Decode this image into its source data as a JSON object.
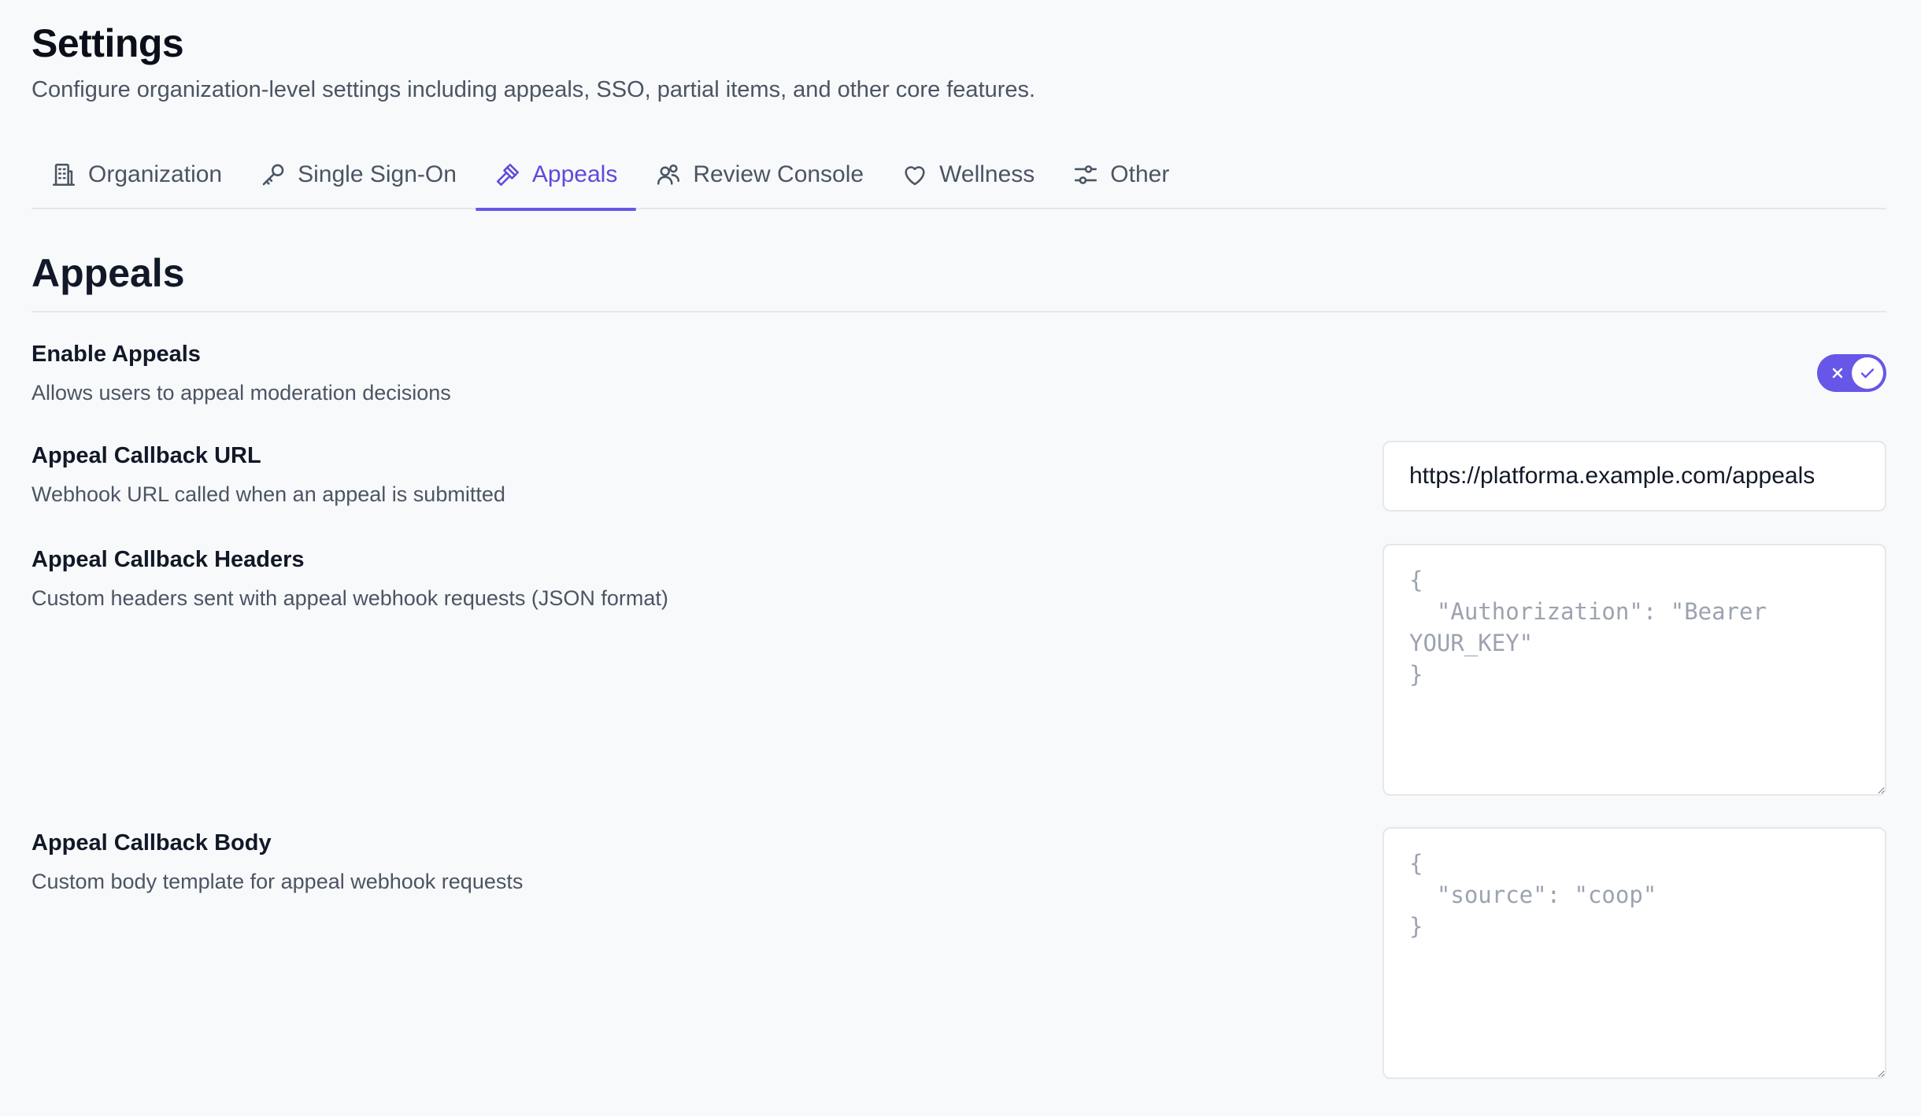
{
  "header": {
    "title": "Settings",
    "subtitle": "Configure organization-level settings including appeals, SSO, partial items, and other core features."
  },
  "tabs": [
    {
      "label": "Organization",
      "icon": "building-icon",
      "active": false
    },
    {
      "label": "Single Sign-On",
      "icon": "key-icon",
      "active": false
    },
    {
      "label": "Appeals",
      "icon": "gavel-icon",
      "active": true
    },
    {
      "label": "Review Console",
      "icon": "users-icon",
      "active": false
    },
    {
      "label": "Wellness",
      "icon": "heart-icon",
      "active": false
    },
    {
      "label": "Other",
      "icon": "sliders-icon",
      "active": false
    }
  ],
  "section": {
    "title": "Appeals"
  },
  "settings": {
    "enable_appeals": {
      "label": "Enable Appeals",
      "description": "Allows users to appeal moderation decisions",
      "enabled": true
    },
    "callback_url": {
      "label": "Appeal Callback URL",
      "description": "Webhook URL called when an appeal is submitted",
      "value": "https://platforma.example.com/appeals"
    },
    "callback_headers": {
      "label": "Appeal Callback Headers",
      "description": "Custom headers sent with appeal webhook requests (JSON format)",
      "placeholder": "{\n  \"Authorization\": \"Bearer YOUR_KEY\"\n}"
    },
    "callback_body": {
      "label": "Appeal Callback Body",
      "description": "Custom body template for appeal webhook requests",
      "placeholder": "{\n  \"source\": \"coop\"\n}"
    }
  },
  "colors": {
    "accent": "#6657e8",
    "background": "#f8f9fb",
    "border": "#e5e7eb",
    "muted_text": "#4b5563"
  }
}
